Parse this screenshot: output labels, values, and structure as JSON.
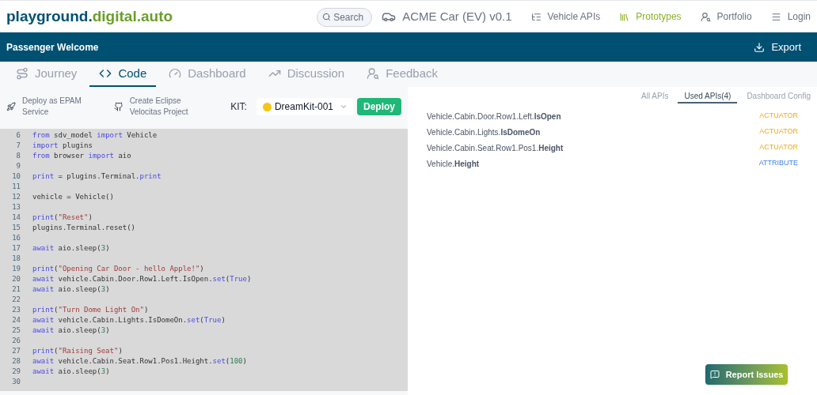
{
  "header": {
    "logo_primary": "playground.",
    "logo_secondary": "digital.auto",
    "search": {
      "placeholder": "Search"
    },
    "model": "ACME Car (EV) v0.1",
    "nav": [
      {
        "label": "Vehicle APIs",
        "selected": false
      },
      {
        "label": "Prototypes",
        "selected": true
      },
      {
        "label": "Portfolio",
        "selected": false
      },
      {
        "label": "Login",
        "selected": false
      }
    ]
  },
  "title_bar": {
    "title": "Passenger Welcome",
    "export": "Export"
  },
  "tabs": [
    {
      "label": "Journey",
      "selected": false
    },
    {
      "label": "Code",
      "selected": true
    },
    {
      "label": "Dashboard",
      "selected": false
    },
    {
      "label": "Discussion",
      "selected": false
    },
    {
      "label": "Feedback",
      "selected": false
    }
  ],
  "toolbar": {
    "actions": [
      {
        "label": "Deploy as EPAM Service"
      },
      {
        "label": "Create Eclipse Velocitas Project"
      }
    ],
    "kit_label": "KIT:",
    "kit": {
      "value": "DreamKit-001",
      "color": "#f5c518"
    },
    "deploy": "Deploy"
  },
  "code": [
    {
      "number": "6",
      "segments": [
        {
          "kind": "kw",
          "text": "from"
        },
        {
          "kind": "plain",
          "text": " sdv_model "
        },
        {
          "kind": "kw",
          "text": "import"
        },
        {
          "kind": "plain",
          "text": " Vehicle"
        }
      ]
    },
    {
      "number": "7",
      "segments": [
        {
          "kind": "kw",
          "text": "import"
        },
        {
          "kind": "plain",
          "text": " plugins"
        }
      ]
    },
    {
      "number": "8",
      "segments": [
        {
          "kind": "kw",
          "text": "from"
        },
        {
          "kind": "plain",
          "text": " browser "
        },
        {
          "kind": "kw",
          "text": "import"
        },
        {
          "kind": "plain",
          "text": " aio"
        }
      ]
    },
    {
      "number": "9"
    },
    {
      "number": "10",
      "segments": [
        {
          "kind": "kw",
          "text": "print"
        },
        {
          "kind": "plain",
          "text": " = plugins.Terminal."
        },
        {
          "kind": "kw",
          "text": "print"
        }
      ]
    },
    {
      "number": "11"
    },
    {
      "number": "12",
      "segments": [
        {
          "kind": "plain",
          "text": "vehicle = Vehicle()"
        }
      ]
    },
    {
      "number": "13"
    },
    {
      "number": "14",
      "segments": [
        {
          "kind": "kw",
          "text": "print"
        },
        {
          "kind": "plain",
          "text": "("
        },
        {
          "kind": "str",
          "text": "\"Reset\""
        },
        {
          "kind": "plain",
          "text": ")"
        }
      ]
    },
    {
      "number": "15",
      "segments": [
        {
          "kind": "plain",
          "text": "plugins.Terminal.reset()"
        }
      ]
    },
    {
      "number": "16"
    },
    {
      "number": "17",
      "segments": [
        {
          "kind": "kw",
          "text": "await"
        },
        {
          "kind": "plain",
          "text": " aio.sleep("
        },
        {
          "kind": "num",
          "text": "3"
        },
        {
          "kind": "plain",
          "text": ")"
        }
      ]
    },
    {
      "number": "18"
    },
    {
      "number": "19",
      "segments": [
        {
          "kind": "kw",
          "text": "print"
        },
        {
          "kind": "plain",
          "text": "("
        },
        {
          "kind": "str",
          "text": "\"Opening Car Door - hello Apple!\""
        },
        {
          "kind": "plain",
          "text": ")"
        }
      ]
    },
    {
      "number": "20",
      "segments": [
        {
          "kind": "kw",
          "text": "await"
        },
        {
          "kind": "plain",
          "text": " vehicle.Cabin.Door.Row1.Left.IsOpen."
        },
        {
          "kind": "kw",
          "text": "set"
        },
        {
          "kind": "plain",
          "text": "("
        },
        {
          "kind": "kw",
          "text": "True"
        },
        {
          "kind": "plain",
          "text": ")"
        }
      ]
    },
    {
      "number": "21",
      "segments": [
        {
          "kind": "kw",
          "text": "await"
        },
        {
          "kind": "plain",
          "text": " aio.sleep("
        },
        {
          "kind": "num",
          "text": "3"
        },
        {
          "kind": "plain",
          "text": ")"
        }
      ]
    },
    {
      "number": "22"
    },
    {
      "number": "23",
      "segments": [
        {
          "kind": "kw",
          "text": "print"
        },
        {
          "kind": "plain",
          "text": "("
        },
        {
          "kind": "str",
          "text": "\"Turn Dome Light On\""
        },
        {
          "kind": "plain",
          "text": ")"
        }
      ]
    },
    {
      "number": "24",
      "segments": [
        {
          "kind": "kw",
          "text": "await"
        },
        {
          "kind": "plain",
          "text": " vehicle.Cabin.Lights.IsDomeOn."
        },
        {
          "kind": "kw",
          "text": "set"
        },
        {
          "kind": "plain",
          "text": "("
        },
        {
          "kind": "kw",
          "text": "True"
        },
        {
          "kind": "plain",
          "text": ")"
        }
      ]
    },
    {
      "number": "25",
      "segments": [
        {
          "kind": "kw",
          "text": "await"
        },
        {
          "kind": "plain",
          "text": " aio.sleep("
        },
        {
          "kind": "num",
          "text": "3"
        },
        {
          "kind": "plain",
          "text": ")"
        }
      ]
    },
    {
      "number": "26"
    },
    {
      "number": "27",
      "segments": [
        {
          "kind": "kw",
          "text": "print"
        },
        {
          "kind": "plain",
          "text": "("
        },
        {
          "kind": "str",
          "text": "\"Raising Seat\""
        },
        {
          "kind": "plain",
          "text": ")"
        }
      ]
    },
    {
      "number": "28",
      "segments": [
        {
          "kind": "kw",
          "text": "await"
        },
        {
          "kind": "plain",
          "text": " vehicle.Cabin.Seat.Row1.Pos1.Height."
        },
        {
          "kind": "kw",
          "text": "set"
        },
        {
          "kind": "plain",
          "text": "("
        },
        {
          "kind": "num",
          "text": "100"
        },
        {
          "kind": "plain",
          "text": ")"
        }
      ]
    },
    {
      "number": "29",
      "segments": [
        {
          "kind": "kw",
          "text": "await"
        },
        {
          "kind": "plain",
          "text": " aio.sleep("
        },
        {
          "kind": "num",
          "text": "3"
        },
        {
          "kind": "plain",
          "text": ")"
        }
      ]
    },
    {
      "number": "30"
    }
  ],
  "api_tabs": [
    {
      "label": "All APIs",
      "selected": false
    },
    {
      "label": "Used APIs(4)",
      "selected": true
    },
    {
      "label": "Dashboard Config",
      "selected": false
    }
  ],
  "apis": [
    {
      "name": "Vehicle.Cabin.Door.Row1.Left.**IsOpen**",
      "type": "ACTUATOR",
      "kind": "actuator"
    },
    {
      "name": "Vehicle.Cabin.Lights.**IsDomeOn**",
      "type": "ACTUATOR",
      "kind": "actuator"
    },
    {
      "name": "Vehicle.Cabin.Seat.Row1.Pos1.**Height**",
      "type": "ACTUATOR",
      "kind": "actuator"
    },
    {
      "name": "Vehicle.**Height**",
      "type": "ATTRIBUTE",
      "kind": "attribute"
    }
  ],
  "report_button": "Report Issues"
}
